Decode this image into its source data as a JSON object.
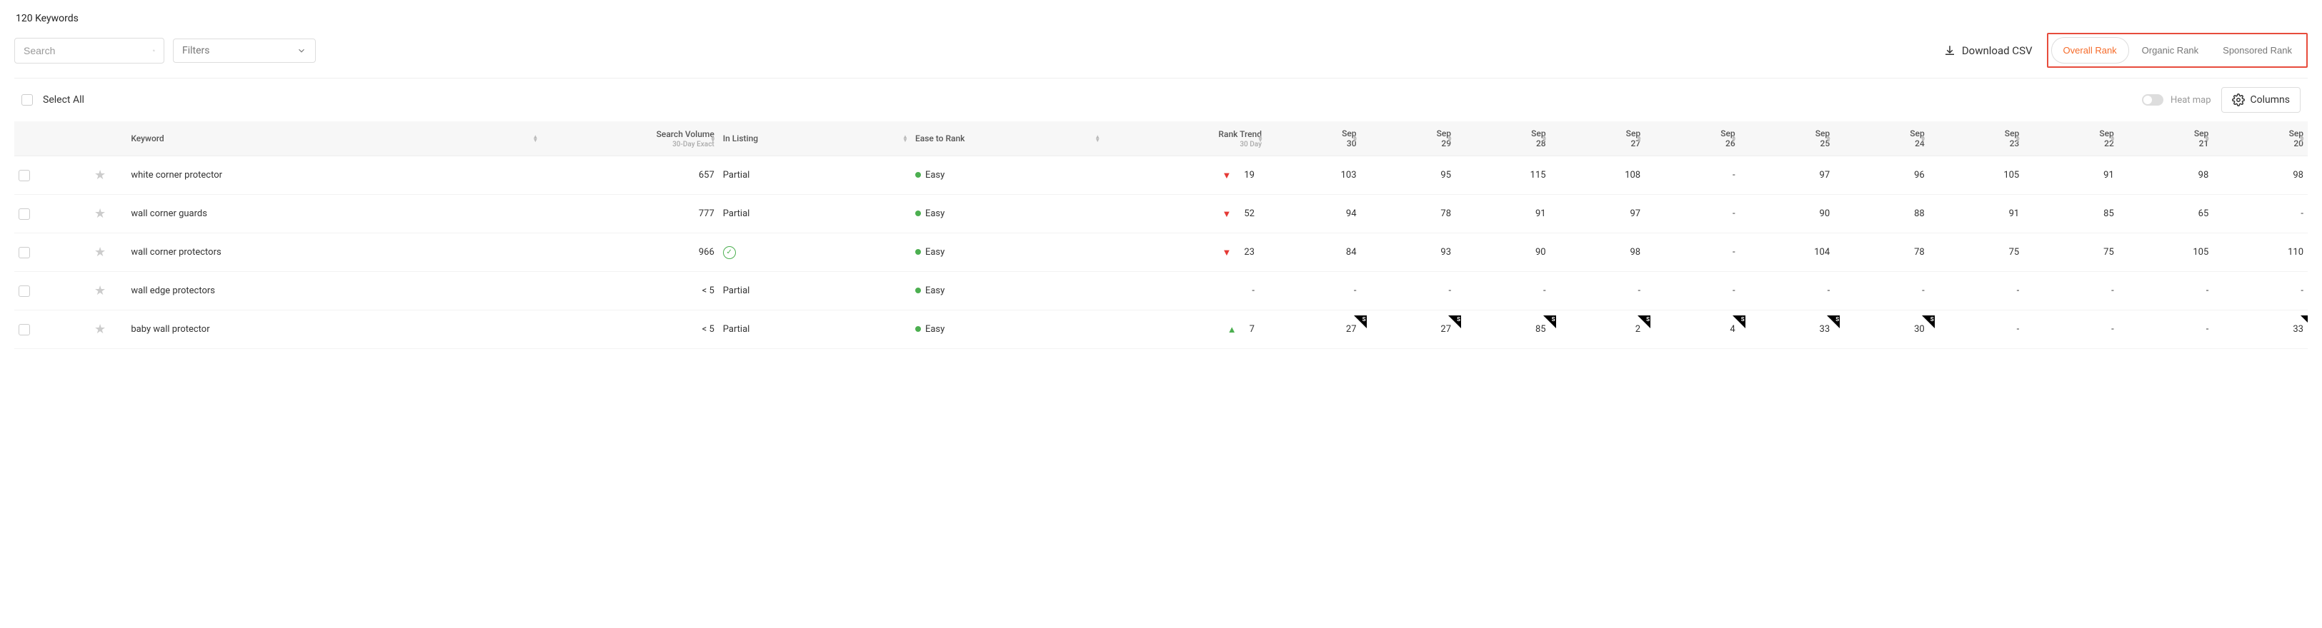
{
  "header": {
    "title": "120 Keywords",
    "search_placeholder": "Search",
    "filters_label": "Filters",
    "download_label": "Download CSV"
  },
  "tabs": {
    "overall": "Overall Rank",
    "organic": "Organic Rank",
    "sponsored": "Sponsored Rank"
  },
  "table_controls": {
    "select_all": "Select All",
    "heat_map": "Heat map",
    "columns": "Columns"
  },
  "columns": {
    "keyword": "Keyword",
    "search_volume": "Search Volume",
    "search_volume_sub": "30-Day Exact",
    "in_listing": "In Listing",
    "ease_to_rank": "Ease to Rank",
    "rank_trend": "Rank Trend",
    "rank_trend_sub": "30 Day",
    "dates": [
      "Sep 30",
      "Sep 29",
      "Sep 28",
      "Sep 27",
      "Sep 26",
      "Sep 25",
      "Sep 24",
      "Sep 23",
      "Sep 22",
      "Sep 21",
      "Sep 20"
    ]
  },
  "ease_labels": {
    "easy": "Easy"
  },
  "listing_labels": {
    "partial": "Partial"
  },
  "rows": [
    {
      "keyword": "white corner protector",
      "search_volume": "657",
      "in_listing": "partial",
      "ease": "easy",
      "trend_dir": "down",
      "trend_val": "19",
      "dates": [
        {
          "v": "103"
        },
        {
          "v": "95"
        },
        {
          "v": "115"
        },
        {
          "v": "108"
        },
        {
          "v": "-"
        },
        {
          "v": "97"
        },
        {
          "v": "96"
        },
        {
          "v": "105"
        },
        {
          "v": "91"
        },
        {
          "v": "98"
        },
        {
          "v": "98"
        }
      ]
    },
    {
      "keyword": "wall corner guards",
      "search_volume": "777",
      "in_listing": "partial",
      "ease": "easy",
      "trend_dir": "down",
      "trend_val": "52",
      "dates": [
        {
          "v": "94"
        },
        {
          "v": "78"
        },
        {
          "v": "91"
        },
        {
          "v": "97"
        },
        {
          "v": "-"
        },
        {
          "v": "90"
        },
        {
          "v": "88"
        },
        {
          "v": "91"
        },
        {
          "v": "85"
        },
        {
          "v": "65"
        },
        {
          "v": "-"
        }
      ]
    },
    {
      "keyword": "wall corner protectors",
      "search_volume": "966",
      "in_listing": "check",
      "ease": "easy",
      "trend_dir": "down",
      "trend_val": "23",
      "dates": [
        {
          "v": "84"
        },
        {
          "v": "93"
        },
        {
          "v": "90"
        },
        {
          "v": "98"
        },
        {
          "v": "-"
        },
        {
          "v": "104"
        },
        {
          "v": "78"
        },
        {
          "v": "75"
        },
        {
          "v": "75"
        },
        {
          "v": "105"
        },
        {
          "v": "110"
        }
      ]
    },
    {
      "keyword": "wall edge protectors",
      "search_volume": "< 5",
      "in_listing": "partial",
      "ease": "easy",
      "trend_dir": "none",
      "trend_val": "-",
      "dates": [
        {
          "v": "-"
        },
        {
          "v": "-"
        },
        {
          "v": "-"
        },
        {
          "v": "-"
        },
        {
          "v": "-"
        },
        {
          "v": "-"
        },
        {
          "v": "-"
        },
        {
          "v": "-"
        },
        {
          "v": "-"
        },
        {
          "v": "-"
        },
        {
          "v": "-"
        }
      ]
    },
    {
      "keyword": "baby wall protector",
      "search_volume": "< 5",
      "in_listing": "partial",
      "ease": "easy",
      "trend_dir": "up",
      "trend_val": "7",
      "dates": [
        {
          "v": "27",
          "s": true
        },
        {
          "v": "27",
          "s": true
        },
        {
          "v": "85",
          "s": true
        },
        {
          "v": "2",
          "s": true
        },
        {
          "v": "4",
          "s": true
        },
        {
          "v": "33",
          "s": true
        },
        {
          "v": "30",
          "s": true
        },
        {
          "v": "-"
        },
        {
          "v": "-"
        },
        {
          "v": "-"
        },
        {
          "v": "33",
          "s": true
        }
      ]
    }
  ]
}
